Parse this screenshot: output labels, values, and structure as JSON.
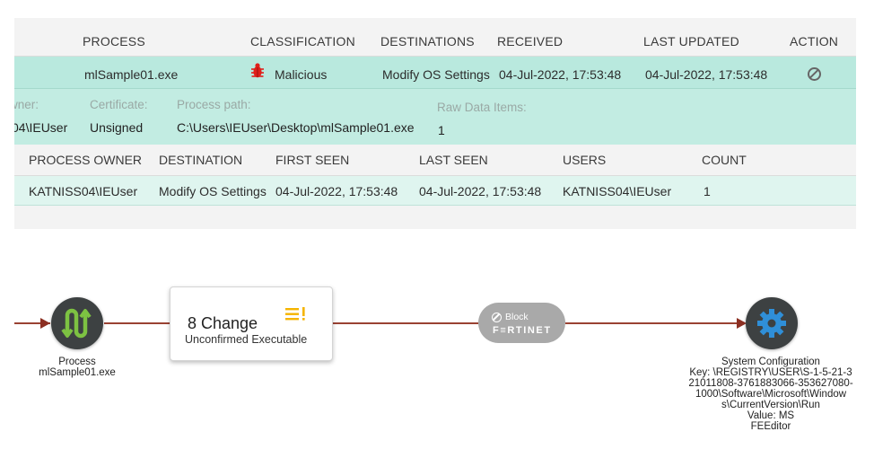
{
  "table": {
    "headers": [
      "PROCESS",
      "CLASSIFICATION",
      "DESTINATIONS",
      "RECEIVED",
      "LAST UPDATED",
      "ACTION"
    ],
    "selected_row": {
      "process": "mlSample01.exe",
      "classification": "Malicious",
      "destinations": "Modify OS Settings",
      "received": "04-Jul-2022, 17:53:48",
      "last_updated": "04-Jul-2022, 17:53:48"
    },
    "details": {
      "owner_label": "wner:",
      "owner_value": "04\\IEUser",
      "certificate_label": "Certificate:",
      "certificate_value": "Unsigned",
      "path_label": "Process path:",
      "path_value": "C:\\Users\\IEUser\\Desktop\\mlSample01.exe",
      "raw_label": "Raw Data Items:",
      "raw_value": "1"
    },
    "sub_headers": [
      "PROCESS OWNER",
      "DESTINATION",
      "FIRST SEEN",
      "LAST SEEN",
      "USERS",
      "COUNT"
    ],
    "sub_row": {
      "owner": "KATNISS04\\IEUser",
      "destination": "Modify OS Settings",
      "first_seen": "04-Jul-2022, 17:53:48",
      "last_seen": "04-Jul-2022, 17:53:48",
      "users": "KATNISS04\\IEUser",
      "count": "1"
    }
  },
  "flow": {
    "process": {
      "title": "Process",
      "name": "mlSample01.exe",
      "icon": "process-icon"
    },
    "change": {
      "title": "8 Change",
      "subtitle": "Unconfirmed Executable",
      "icon": "alert-list-icon"
    },
    "block": {
      "label": "Block",
      "vendor": "F≡RTINET"
    },
    "target": {
      "lines": [
        "System Configuration",
        "Key: \\REGISTRY\\USER\\S-1-5-21-3",
        "21011808-3761883066-353627080-",
        "1000\\Software\\Microsoft\\Window",
        "s\\CurrentVersion\\Run",
        "Value: MS",
        "FEEditor"
      ],
      "icon": "gear-icon"
    }
  },
  "colors": {
    "selected_row": "#b9e9de",
    "malicious": "#e0201b",
    "flow_line": "#9a4233",
    "node": "#3d4142",
    "gear": "#2f8fd8",
    "process_icon": "#7dc242",
    "alert_icon": "#f5b400"
  }
}
